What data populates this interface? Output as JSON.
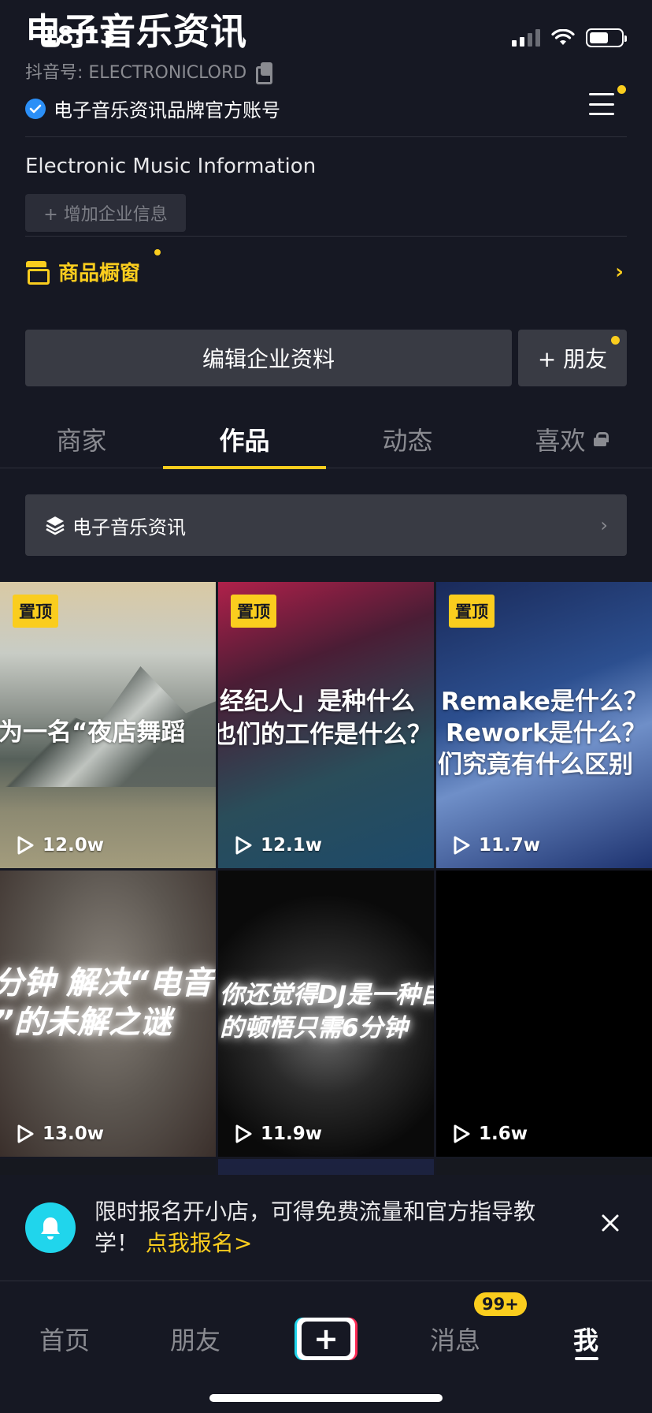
{
  "status_bar": {
    "time": "18:13"
  },
  "profile": {
    "name": "电子音乐资讯",
    "douyin_id": "抖音号: ELECTRONICLORD",
    "verified_label": "电子音乐资讯品牌官方账号",
    "bio": "Electronic Music Information",
    "add_info_label": "+ 增加企业信息",
    "shop_label": "商品橱窗",
    "edit_button": "编辑企业资料",
    "friend_button": "+ 朋友"
  },
  "tabs": [
    {
      "label": "商家"
    },
    {
      "label": "作品"
    },
    {
      "label": "动态"
    },
    {
      "label": "喜欢"
    }
  ],
  "collection": {
    "label": "电子音乐资讯"
  },
  "pin_label": "置顶",
  "videos": [
    {
      "text": "为一名“夜店舞蹈",
      "views": "12.0w"
    },
    {
      "text_line1": "经纪人」是种什么",
      "text_line2": "也们的工作是什么？",
      "views": "12.1w"
    },
    {
      "text_line1": "Remake是什么？",
      "text_line2": "Rework是什么？",
      "text_line3": "们究竟有什么区别",
      "views": "11.7w"
    },
    {
      "text_line1": "分钟  解决“电音",
      "text_line2": "”的未解之谜",
      "views": "13.0w"
    },
    {
      "text_line1": "你还觉得DJ是一种自",
      "text_line2": "的顿悟只需6分钟",
      "views": "11.9w"
    },
    {
      "views": "1.6w"
    }
  ],
  "notice": {
    "text": "限时报名开小店，可得免费流量和官方指导教学！",
    "link": "点我报名>"
  },
  "tabbar": {
    "home": "首页",
    "friends": "朋友",
    "messages": "消息",
    "messages_badge": "99+",
    "me": "我"
  },
  "colors": {
    "background": "#161823",
    "accent_yellow": "#facd1e",
    "verified_blue": "#2b8ff7",
    "bell_cyan": "#20d5ec",
    "plus_red": "#fe2c55"
  }
}
